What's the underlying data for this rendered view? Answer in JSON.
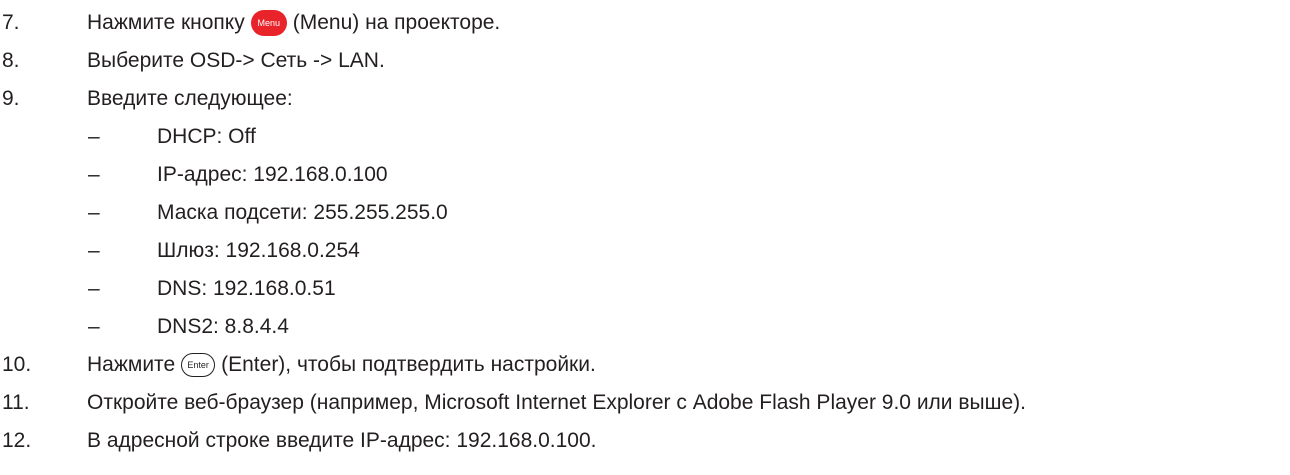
{
  "steps": [
    {
      "number": "7.",
      "before": "Нажмите кнопку",
      "button": "Menu",
      "after": "(Menu) на проекторе."
    },
    {
      "number": "8.",
      "text": "Выберите OSD-> Сеть -> LAN."
    },
    {
      "number": "9.",
      "text": "Введите следующее:",
      "subitems": [
        {
          "dash": "–",
          "text": "DHCP: Off"
        },
        {
          "dash": "–",
          "text": "IP-адрес: 192.168.0.100"
        },
        {
          "dash": "–",
          "text": "Маска подсети: 255.255.255.0"
        },
        {
          "dash": "–",
          "text": "Шлюз: 192.168.0.254"
        },
        {
          "dash": "–",
          "text": "DNS: 192.168.0.51"
        },
        {
          "dash": "–",
          "text": "DNS2: 8.8.4.4"
        }
      ]
    },
    {
      "number": "10.",
      "before": "Нажмите",
      "button": "Enter",
      "after": "(Enter), чтобы подтвердить настройки."
    },
    {
      "number": "11.",
      "text": "Откройте веб-браузер (например, Microsoft Internet Explorer с Adobe Flash Player 9.0 или выше)."
    },
    {
      "number": "12.",
      "text": "В адресной строке введите IP-адрес: 192.168.0.100."
    }
  ],
  "icons": {
    "menu_button_color": "#e8232a",
    "enter_button_color": "#ffffff"
  }
}
